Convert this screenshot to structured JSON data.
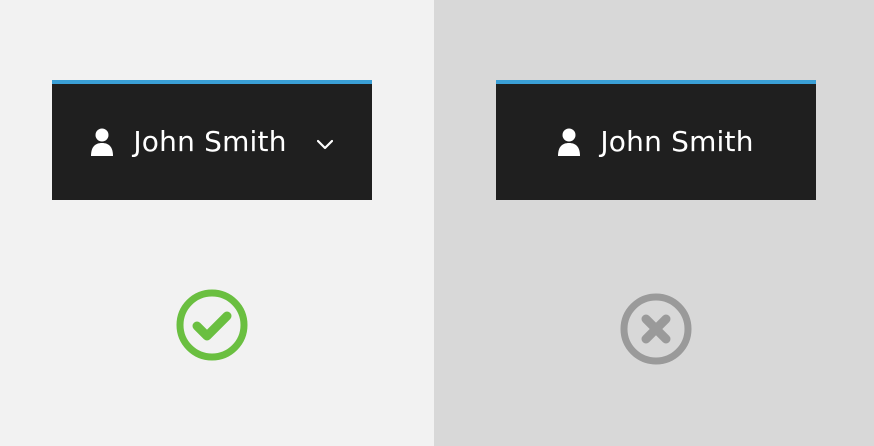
{
  "correct_example": {
    "user_name": "John Smith",
    "icons": {
      "user": "user-icon",
      "dropdown": "chevron-down-icon",
      "status": "check-circle-icon"
    },
    "colors": {
      "panel_background": "#f2f2f2",
      "bar_background": "#1f1f1f",
      "bar_accent": "#3a9fd6",
      "status": "#6abf40"
    }
  },
  "incorrect_example": {
    "user_name": "John Smith",
    "icons": {
      "user": "user-icon",
      "status": "x-circle-icon"
    },
    "colors": {
      "panel_background": "#d8d8d8",
      "bar_background": "#1f1f1f",
      "bar_accent": "#3a9fd6",
      "status": "#9a9a9a"
    }
  }
}
